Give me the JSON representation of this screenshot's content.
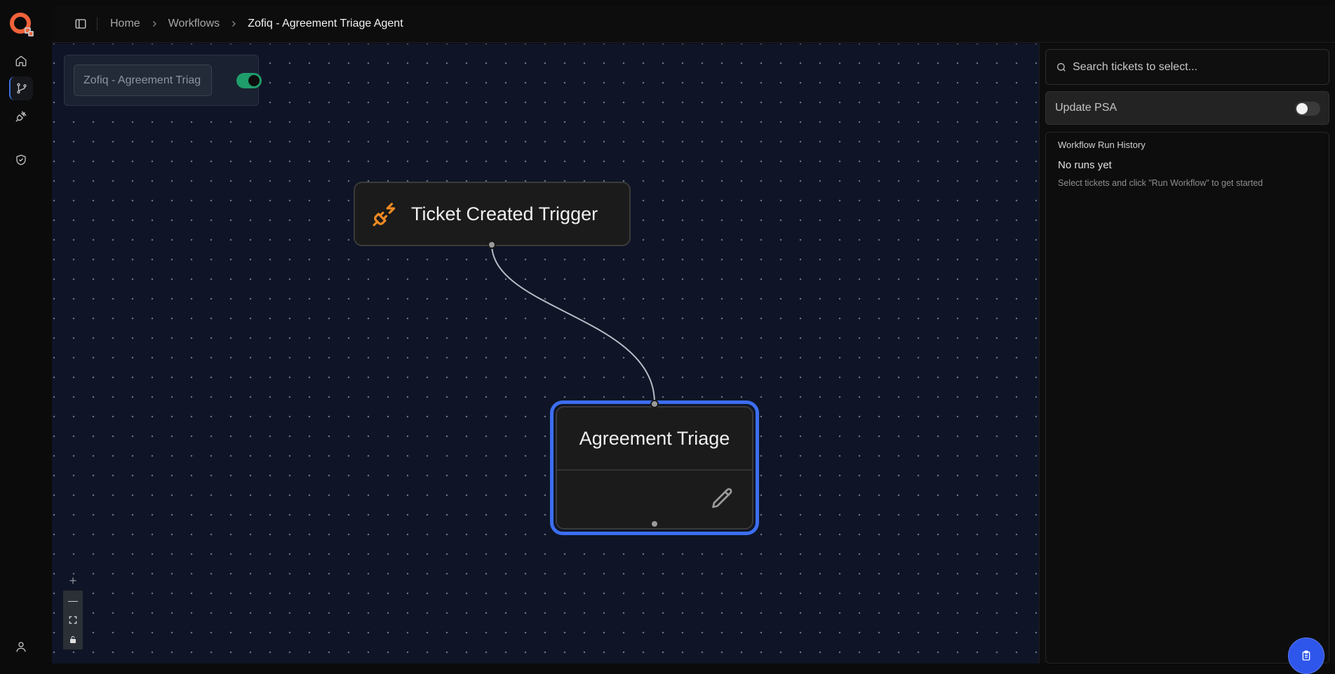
{
  "breadcrumb": {
    "items": [
      "Home",
      "Workflows"
    ],
    "current": "Zofiq - Agreement Triage Agent"
  },
  "workflow": {
    "name_value": "Zofiq - Agreement Triag",
    "enabled": true
  },
  "nodes": {
    "trigger_title": "Ticket Created Trigger",
    "action_title": "Agreement Triage"
  },
  "zoom_controls": {
    "plus": "+",
    "minus": "—"
  },
  "right_panel": {
    "search_placeholder": "Search tickets to select...",
    "update_psa_label": "Update PSA",
    "update_psa_enabled": false,
    "history_title": "Workflow Run History",
    "no_runs": "No runs yet",
    "hint": "Select tickets and click \"Run Workflow\" to get started"
  },
  "colors": {
    "accent": "#3c6ef0",
    "toggle_on": "#1f9d6b",
    "logo": "#f0623a",
    "trigger_icon": "#f08a24",
    "canvas_bg": "#0f1526"
  }
}
